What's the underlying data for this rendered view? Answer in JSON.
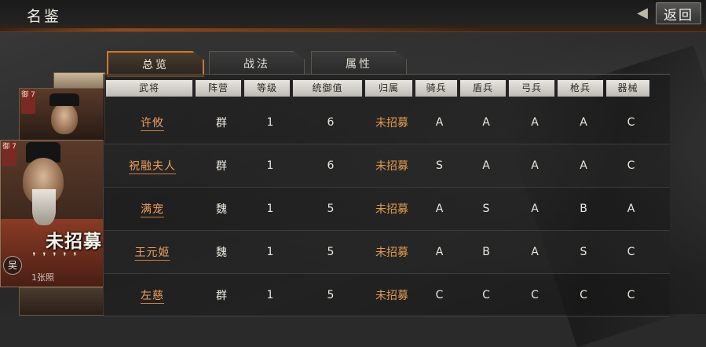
{
  "header": {
    "title": "名鉴",
    "back_label": "返回"
  },
  "portrait": {
    "back_stat": "御\n7",
    "main_stat": "御\n7",
    "recruit_label": "未招募",
    "faction": "吴",
    "fragment_label": "1张照"
  },
  "tabs": [
    {
      "label": "总览",
      "active": true
    },
    {
      "label": "战法",
      "active": false
    },
    {
      "label": "属性",
      "active": false
    }
  ],
  "table": {
    "columns": [
      "武将",
      "阵营",
      "等级",
      "统御值",
      "归属",
      "骑兵",
      "盾兵",
      "弓兵",
      "枪兵",
      "器械"
    ],
    "rows": [
      [
        "许攸",
        "群",
        "1",
        "6",
        "未招募",
        "A",
        "A",
        "A",
        "A",
        "C"
      ],
      [
        "祝融夫人",
        "群",
        "1",
        "6",
        "未招募",
        "S",
        "A",
        "A",
        "A",
        "C"
      ],
      [
        "满宠",
        "魏",
        "1",
        "5",
        "未招募",
        "A",
        "S",
        "A",
        "B",
        "A"
      ],
      [
        "王元姬",
        "魏",
        "1",
        "5",
        "未招募",
        "A",
        "B",
        "A",
        "S",
        "C"
      ],
      [
        "左慈",
        "群",
        "1",
        "5",
        "未招募",
        "C",
        "C",
        "C",
        "C",
        "C"
      ]
    ]
  },
  "colors": {
    "accent": "#c97a34",
    "name_link": "#f0a060",
    "belong": "#e09a4f"
  }
}
